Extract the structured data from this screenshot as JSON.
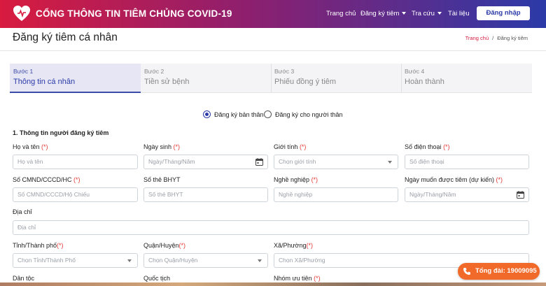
{
  "header": {
    "brand": "CỔNG THÔNG TIN TIÊM CHỦNG COVID-19",
    "nav": {
      "home": "Trang chủ",
      "register": "Đăng ký tiêm",
      "lookup": "Tra cứu",
      "docs": "Tài liệu"
    },
    "login": "Đăng nhập"
  },
  "page": {
    "title": "Đăng ký tiêm cá nhân",
    "breadcrumb": {
      "home": "Trang chủ",
      "separator": "/",
      "current": "Đăng ký tiêm"
    }
  },
  "steps": [
    {
      "num": "Bước 1",
      "name": "Thông tin cá nhân",
      "active": true
    },
    {
      "num": "Bước 2",
      "name": "Tiền sử bệnh",
      "active": false
    },
    {
      "num": "Bước 3",
      "name": "Phiếu đồng ý tiêm",
      "active": false
    },
    {
      "num": "Bước 4",
      "name": "Hoàn thành",
      "active": false
    }
  ],
  "register_for": {
    "self": "Đăng ký bản thân",
    "relative": "Đăng ký cho người thân",
    "selected": "self"
  },
  "section_title": "1. Thông tin người đăng ký tiêm",
  "required_mark": "(*)",
  "fields": {
    "full_name": {
      "label": "Họ và tên",
      "placeholder": "Họ và tên"
    },
    "dob": {
      "label": "Ngày sinh",
      "placeholder": "Ngày/Tháng/Năm"
    },
    "gender": {
      "label": "Giới tính",
      "placeholder": "Chọn giới tính"
    },
    "phone": {
      "label": "Số điện thoại",
      "placeholder": "Số điện thoại"
    },
    "id_number": {
      "label": "Số CMND/CCCD/HC",
      "placeholder": "Số CMND/CCCD/Hộ Chiếu"
    },
    "insurance": {
      "label": "Số thẻ BHYT",
      "placeholder": "Số thẻ BHYT"
    },
    "occupation": {
      "label": "Nghề nghiệp",
      "placeholder": "Nghề nghiệp"
    },
    "desired_date": {
      "label": "Ngày muốn được tiêm (dự kiến)",
      "placeholder": "Ngày/Tháng/Năm"
    },
    "address": {
      "label": "Địa chỉ",
      "placeholder": "Địa chỉ"
    },
    "province": {
      "label": "Tỉnh/Thành phố",
      "placeholder": "Chọn Tỉnh/Thành Phố"
    },
    "district": {
      "label": "Quận/Huyện",
      "placeholder": "Chọn Quận/Huyện"
    },
    "ward": {
      "label": "Xã/Phường",
      "placeholder": "Chọn Xã/Phường"
    },
    "ethnicity": {
      "label": "Dân tộc"
    },
    "nationality": {
      "label": "Quốc tịch"
    },
    "priority_group": {
      "label": "Nhóm ưu tiên"
    }
  },
  "hotline": "Tổng đài: 19009095",
  "colors": {
    "accent": "#2b3aa8",
    "brand_red": "#d81b3f",
    "hotline": "#f26a2a",
    "required": "#e53935"
  }
}
